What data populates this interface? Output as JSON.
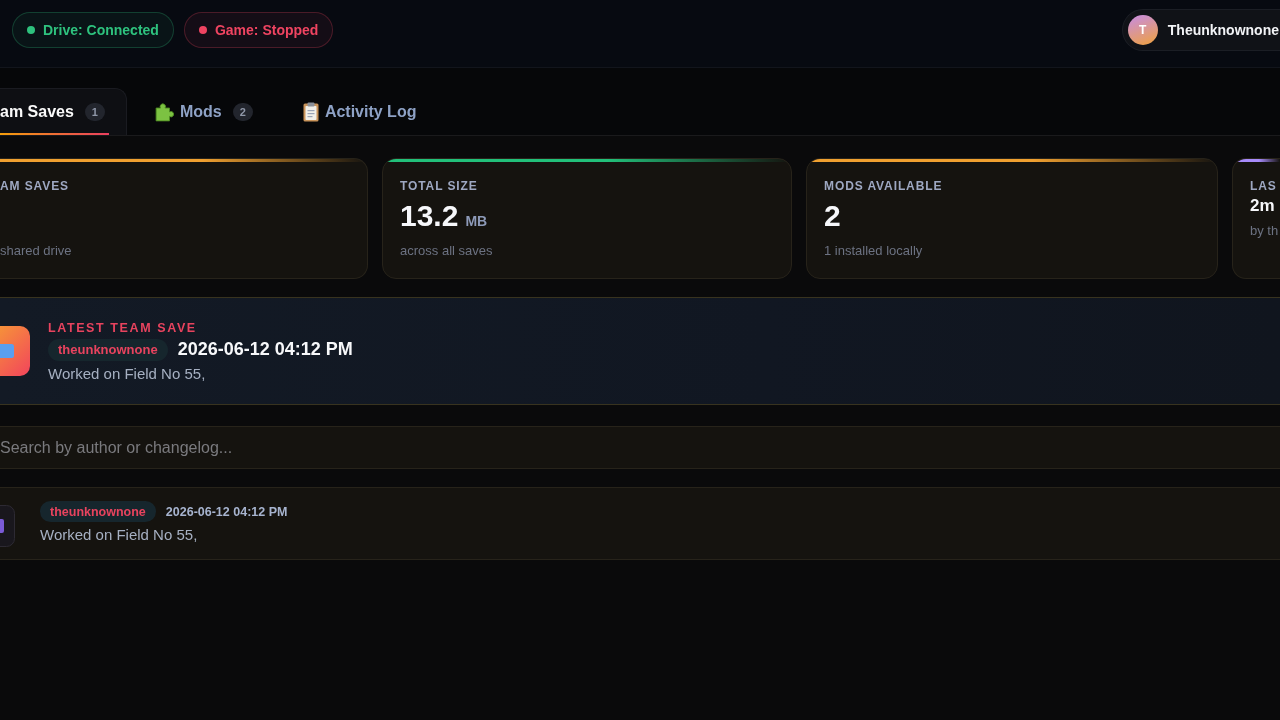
{
  "header": {
    "status_pills": [
      {
        "label": "Drive: Connected",
        "color": "#2ec27e"
      },
      {
        "label": "Game: Stopped",
        "color": "#ef4461"
      }
    ],
    "user": {
      "initial": "T",
      "name": "Theunknownone"
    }
  },
  "tabs": [
    {
      "label": "am Saves",
      "badge": "1",
      "selected": true
    },
    {
      "label": "Mods",
      "badge": "2",
      "selected": false
    },
    {
      "label": "Activity Log",
      "selected": false
    }
  ],
  "stats": [
    {
      "label": "AM SAVES",
      "kind": "number",
      "note": "shared drive",
      "color": "#f0a030"
    },
    {
      "label": "TOTAL SIZE",
      "kind": "number",
      "value": "13.2",
      "unit": "MB",
      "note": "across all saves",
      "color": "#22c07a"
    },
    {
      "label": "MODS AVAILABLE",
      "kind": "number",
      "value": "2",
      "note": "1 installed locally",
      "color": "#f0a030"
    },
    {
      "label": "LAS",
      "kind": "text",
      "value": "2m",
      "note": "by th",
      "color": "#a78bfa"
    }
  ],
  "latest_save": {
    "title": "LATEST TEAM SAVE",
    "author": "theunknownone",
    "date": "2026-06-12 04:12 PM",
    "message": "Worked on Field No 55,"
  },
  "search": {
    "placeholder": "Search by author or changelog..."
  },
  "saves": [
    {
      "author": "theunknownone",
      "date": "2026-06-12 04:12 PM",
      "message": "Worked on Field No 55,"
    }
  ]
}
